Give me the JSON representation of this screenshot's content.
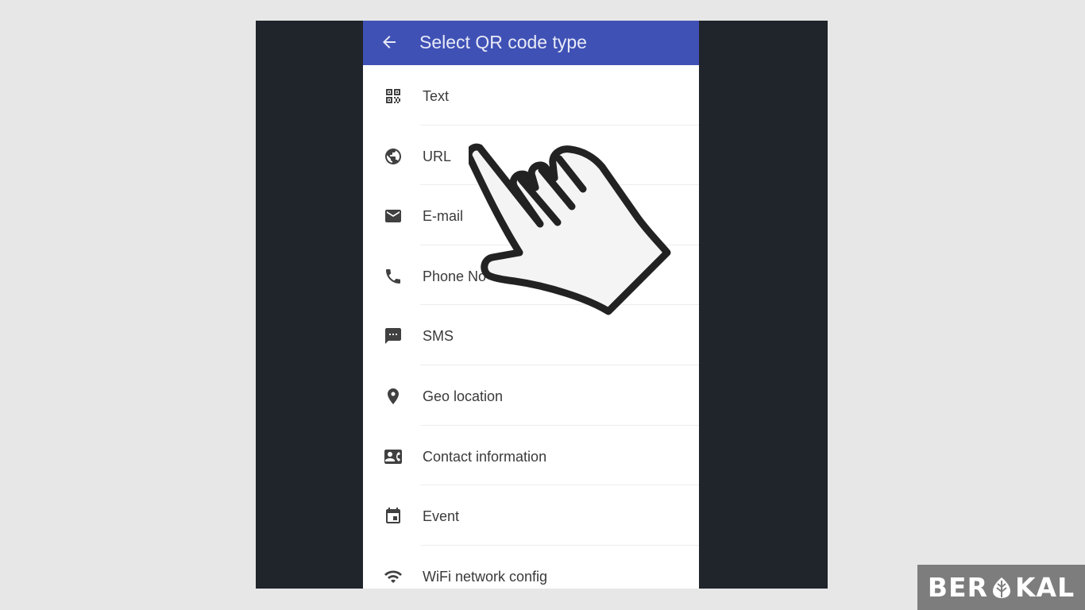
{
  "appbar": {
    "title": "Select QR code type",
    "back_icon": "arrow-back-icon",
    "color": "#3f51b5"
  },
  "items": [
    {
      "label": "Text",
      "icon": "qr-code-icon"
    },
    {
      "label": "URL",
      "icon": "globe-icon"
    },
    {
      "label": "E-mail",
      "icon": "mail-icon"
    },
    {
      "label": "Phone No",
      "icon": "phone-icon"
    },
    {
      "label": "SMS",
      "icon": "sms-icon"
    },
    {
      "label": "Geo location",
      "icon": "location-pin-icon"
    },
    {
      "label": "Contact information",
      "icon": "contact-card-icon"
    },
    {
      "label": "Event",
      "icon": "calendar-icon"
    },
    {
      "label": "WiFi network config",
      "icon": "wifi-icon"
    }
  ],
  "overlay": {
    "pointer_icon": "pointing-hand-icon"
  },
  "watermark": {
    "text_before": "BER",
    "text_after": "KAL",
    "leaf_icon": "leaf-icon",
    "color": "#7d7d7d"
  }
}
